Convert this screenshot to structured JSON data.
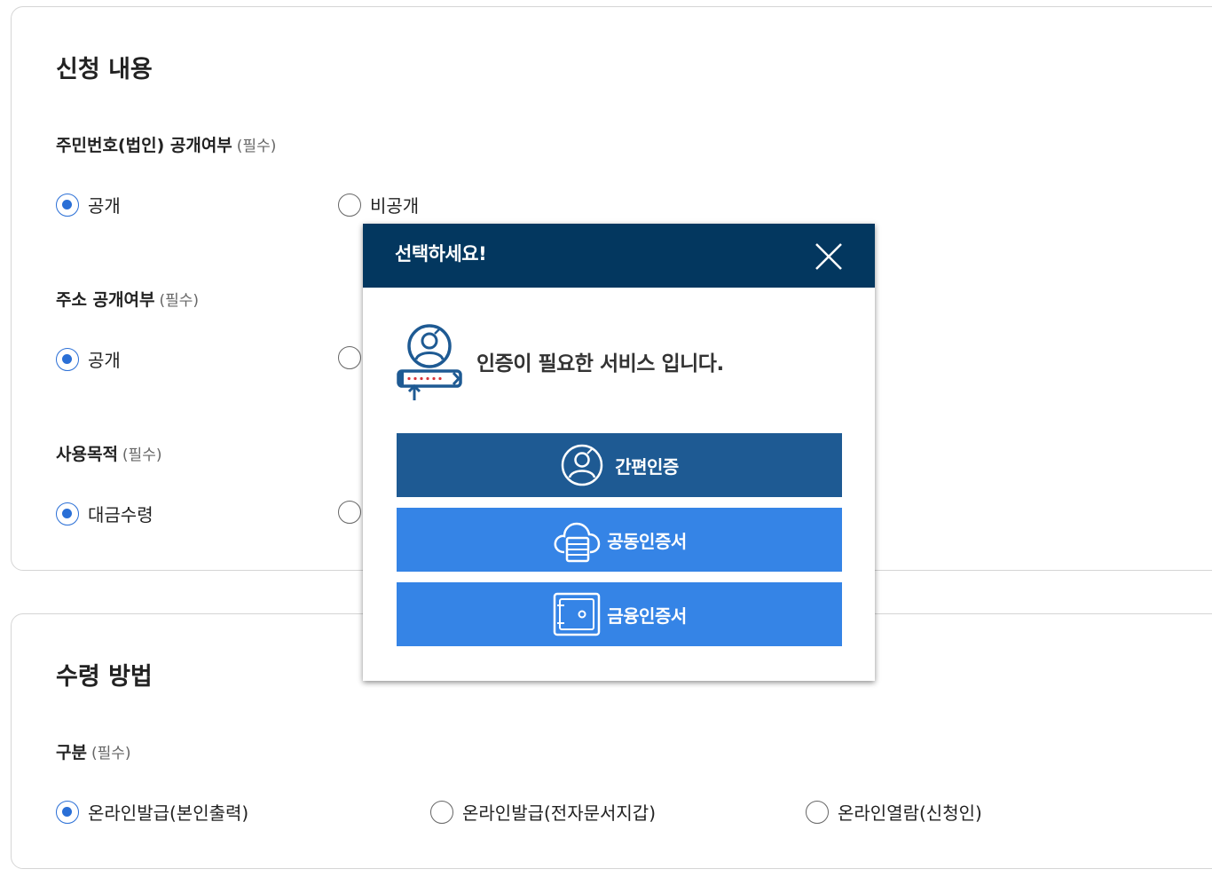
{
  "section1": {
    "title": "신청 내용",
    "fields": [
      {
        "label": "주민번호(법인) 공개여부",
        "required": "(필수)",
        "options": [
          "공개",
          "비공개"
        ],
        "selected": "공개"
      },
      {
        "label": "주소 공개여부",
        "required": "(필수)",
        "options": [
          "공개",
          ""
        ],
        "selected": "공개"
      },
      {
        "label": "사용목적",
        "required": "(필수)",
        "options": [
          "대금수령",
          ""
        ],
        "selected": "대금수령"
      }
    ]
  },
  "section2": {
    "title": "수령 방법",
    "fields": [
      {
        "label": "구분",
        "required": "(필수)",
        "options": [
          "온라인발급(본인출력)",
          "온라인발급(전자문서지갑)",
          "온라인열람(신청인)"
        ],
        "selected": "온라인발급(본인출력)"
      }
    ]
  },
  "modal": {
    "title": "선택하세요!",
    "message": "인증이 필요한 서비스 입니다.",
    "buttons": {
      "simple_auth": "간편인증",
      "joint_cert": "공동인증서",
      "finance_cert": "금융인증서"
    }
  },
  "colors": {
    "modal_header": "#03375f",
    "primary_button": "#1e5a93",
    "secondary_button": "#3584e6",
    "radio_checked": "#2a6fd6"
  }
}
